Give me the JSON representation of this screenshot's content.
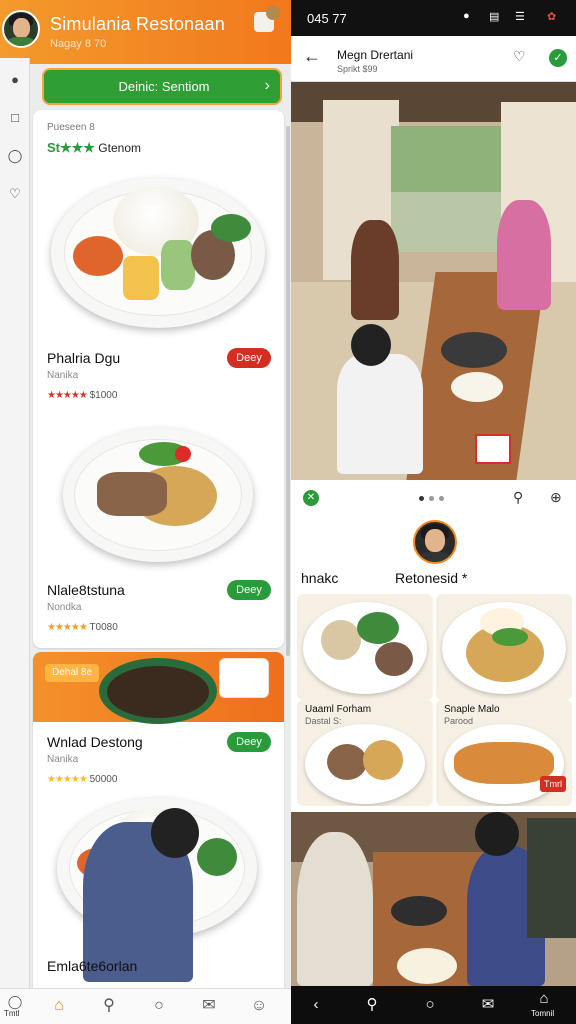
{
  "left_app": {
    "title": "Simulania Restonaan",
    "subtitle": "Nagay 8 70",
    "cta_label": "Deinic: Sentiom",
    "section_label": "Pueseen 8",
    "section_title_stars": "★★★",
    "section_title_prefix": "St",
    "section_title_rest": " Gtenom",
    "dishes": [
      {
        "name": "Phalria Dgu",
        "sub": "Nanika",
        "price": "$1000",
        "button": "Deey",
        "button_color": "#d42d22"
      },
      {
        "name": "Nlale8tstuna",
        "sub": "Nondka",
        "price": "T0080",
        "button": "Deey",
        "button_color": "#2a9b3a"
      },
      {
        "name": "Wnlad Destong",
        "sub": "Nanika",
        "price": "50000",
        "button": "Deey",
        "button_color": "#2a9b3a"
      },
      {
        "name": "Emla6te6orlan",
        "sub": "",
        "price": "",
        "button": "",
        "button_color": "#2a9b3a"
      }
    ],
    "promo_tag": "Dehal 8e",
    "bottom_nav_label": "Tmtl"
  },
  "right_app": {
    "status_time": "045 77",
    "appbar_title": "Megn Drertani",
    "appbar_subtitle": "Sprikt $99",
    "profile_left": "hnakc",
    "profile_right": "Retonesid *",
    "tiles": [
      {
        "title": "",
        "sub": "",
        "badge": ""
      },
      {
        "title": "",
        "sub": "",
        "badge": ""
      },
      {
        "title": "Uaaml Forham",
        "sub": "Dastal S:",
        "badge": ""
      },
      {
        "title": "Snaple Malo",
        "sub": "Parood",
        "badge": "Tmrl"
      }
    ],
    "bottom_nav_label": "Tomnil"
  },
  "colors": {
    "orange_header": "#f2781c",
    "green_accent": "#2a9b3a",
    "red_accent": "#d42d22",
    "dark_bar": "#111111"
  },
  "icons": {
    "left_rail": [
      "compass-icon",
      "document-icon",
      "chat-bubble-icon",
      "heart-icon"
    ],
    "left_nav": [
      "home-icon",
      "search-icon",
      "circle-icon",
      "chat-icon",
      "profile-icon"
    ],
    "right_nav": [
      "back-icon",
      "search-icon",
      "circle-icon",
      "chat-icon",
      "home-icon"
    ]
  }
}
